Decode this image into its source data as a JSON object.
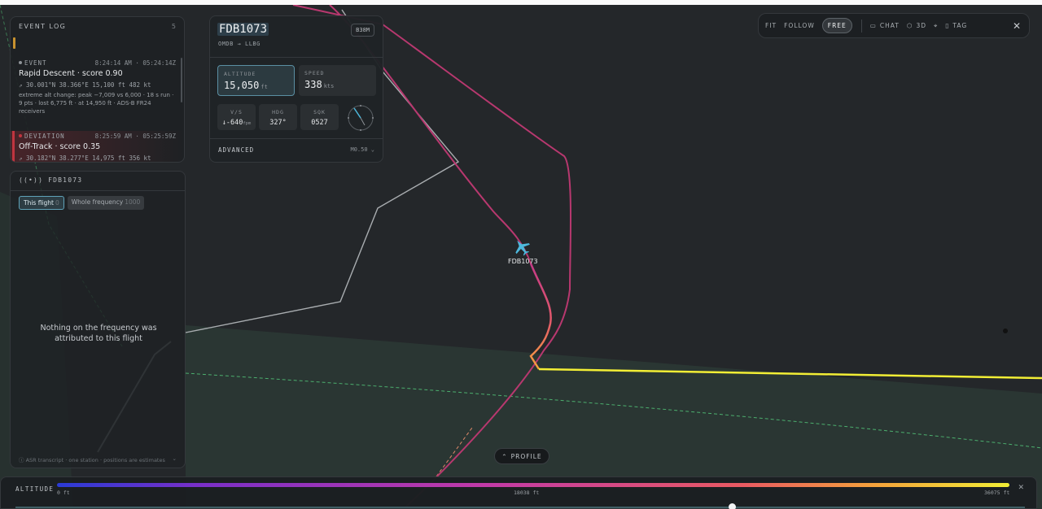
{
  "event_log": {
    "title": "EVENT LOG",
    "count": "5",
    "events": [
      {
        "kind": "EVENT",
        "time": "8:24:14 AM · 05:24:14Z",
        "title": "Rapid Descent · score 0.90",
        "position": "30.001°N 38.366°E 15,100 ft 482 kt",
        "description": "extreme alt change: peak −7,009 vs 6,000 · 18 s run · 9 pts · lost 6,775 ft · at 14,950 ft · ADS-B FR24 receivers",
        "color": "#8e9398"
      },
      {
        "kind": "DEVIATION",
        "time": "8:25:59 AM · 05:25:59Z",
        "title": "Off-Track · score 0.35",
        "position": "30.182°N 38.277°E 14,975 ft 356 kt",
        "color": "#c0353f"
      }
    ]
  },
  "frequency": {
    "title": "FDB1073",
    "tabs": [
      {
        "label": "This flight",
        "count": "0"
      },
      {
        "label": "Whole frequency",
        "count": "1000"
      }
    ],
    "empty_message": "Nothing on the frequency was attributed to this flight",
    "footer": "ASR transcript · one station · positions are estimates"
  },
  "flight": {
    "callsign": "FDB1073",
    "route": "OMDB → LLBG",
    "aircraft_type": "B38M",
    "altitude": {
      "label": "ALTITUDE",
      "value": "15,050",
      "unit": "ft"
    },
    "speed": {
      "label": "SPEED",
      "value": "338",
      "unit": "kts"
    },
    "vs": {
      "label": "V/S",
      "value": "-640",
      "unit": "fpm"
    },
    "hdg": {
      "label": "HDG",
      "value": "327°"
    },
    "sqk": {
      "label": "SQK",
      "value": "0527"
    },
    "advanced_label": "ADVANCED",
    "mach": "M0.50",
    "map_label": "FDB1073"
  },
  "toolbar": {
    "fit": "FIT",
    "follow": "FOLLOW",
    "free": "FREE",
    "chat": "CHAT",
    "threed": "3D",
    "tag": "TAG"
  },
  "profile_button": "PROFILE",
  "altitude_bar": {
    "label": "ALTITUDE",
    "min": "0 ft",
    "mid": "18038 ft",
    "max": "36075 ft",
    "playhead_fraction": 0.71
  },
  "colors": {
    "track_pink": "#b8386f",
    "track_yellow": "#f2ee35",
    "aircraft": "#4db8dc"
  }
}
